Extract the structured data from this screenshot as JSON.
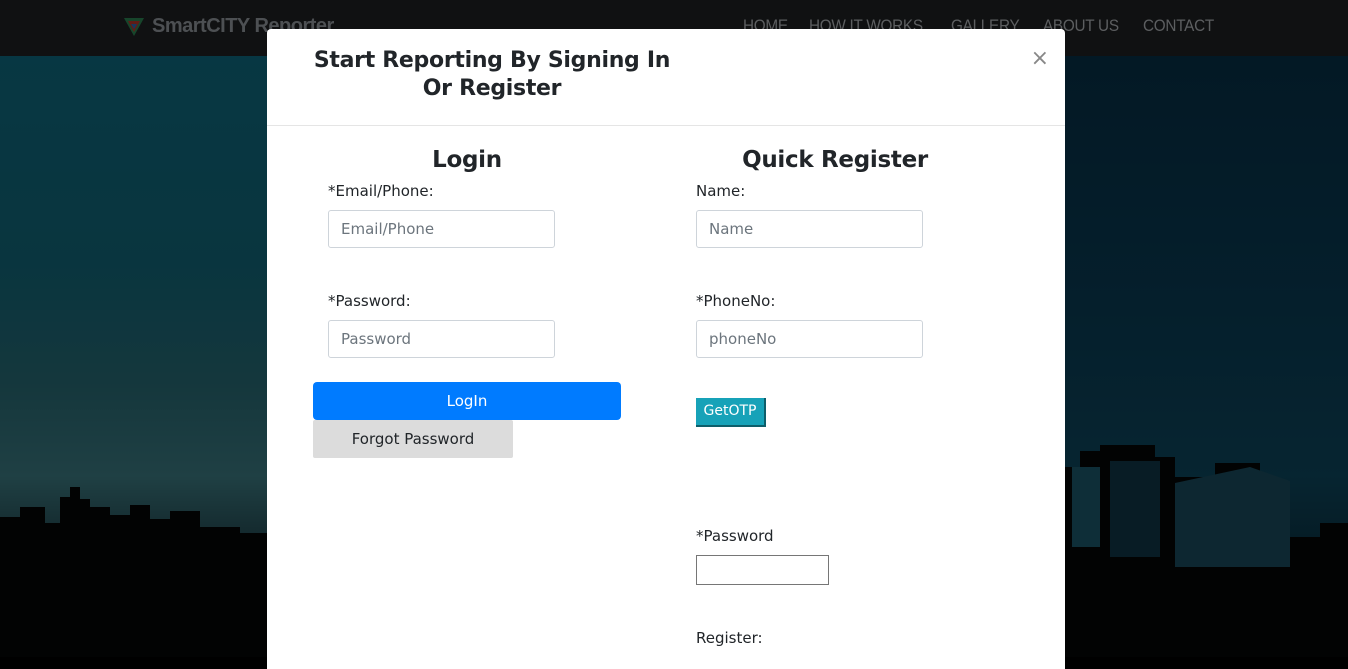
{
  "navbar": {
    "brand": "SmartCITY Reporter",
    "links": [
      "HOME",
      "HOW IT WORKS",
      "GALLERY",
      "ABOUT US",
      "CONTACT"
    ]
  },
  "modal": {
    "title": "Start Reporting By Signing In Or Register",
    "close": "×",
    "login": {
      "heading": "Login",
      "email_label": "*Email/Phone:",
      "email_placeholder": "Email/Phone",
      "password_label": "*Password:",
      "password_placeholder": "Password",
      "login_button": "LogIn",
      "forgot_button": "Forgot Password"
    },
    "register": {
      "heading": "Quick Register",
      "name_label": "Name:",
      "name_placeholder": "Name",
      "phone_label": "*PhoneNo:",
      "phone_placeholder": "phoneNo",
      "otp_button": "GetOTP",
      "password_label": "*Password",
      "register_label": "Register:"
    }
  },
  "colors": {
    "primary": "#007bff",
    "otp": "#17a2b8",
    "navbar": "#212325"
  }
}
